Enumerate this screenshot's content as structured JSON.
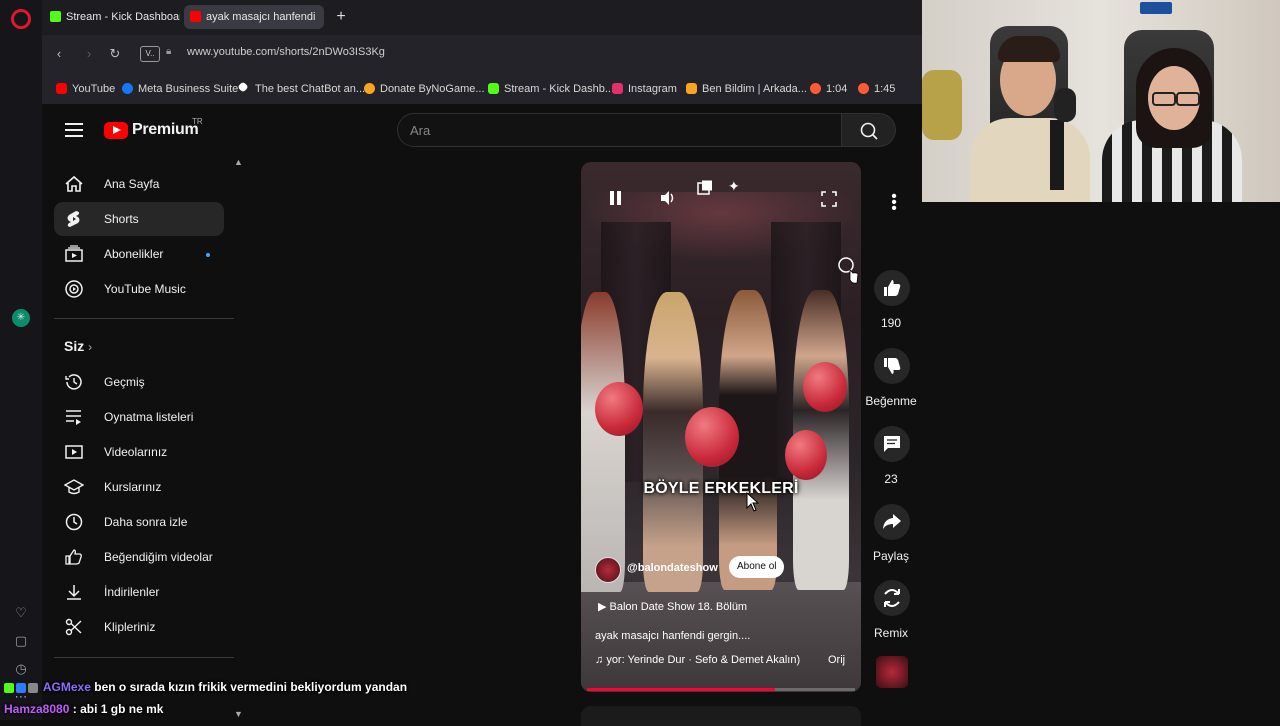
{
  "browser": {
    "tabs": [
      {
        "label": "Stream - Kick Dashboard",
        "active": false,
        "icon": "kick-icon",
        "color": "#53fc18"
      },
      {
        "label": "ayak masajcı hanfendi",
        "active": true,
        "icon": "youtube-icon",
        "color": "#ff0000"
      }
    ],
    "url": "www.youtube.com/shorts/2nDWo3IS3Kg",
    "vpn_label": "V",
    "bookmarks": [
      {
        "label": "YouTube",
        "icon": "youtube-icon",
        "color": "#ff0000"
      },
      {
        "label": "Meta Business Suite",
        "icon": "meta-icon",
        "color": "#1877f2"
      },
      {
        "label": "The best ChatBot an...",
        "icon": "chatbot-icon",
        "color": "#ffffff"
      },
      {
        "label": "Donate ByNoGame...",
        "icon": "bynogame-icon",
        "color": "#f5a623"
      },
      {
        "label": "Stream - Kick Dashb...",
        "icon": "kick-icon",
        "color": "#53fc18"
      },
      {
        "label": "Instagram",
        "icon": "instagram-icon",
        "color": "#e1306c"
      },
      {
        "label": "Ben Bildim | Arkada...",
        "icon": "benbildim-icon",
        "color": "#f5a623"
      },
      {
        "label": "1:04",
        "icon": "timer-icon",
        "color": "#ff5a36"
      },
      {
        "label": "1:45",
        "icon": "timer-icon",
        "color": "#ff5a36"
      }
    ]
  },
  "youtube": {
    "brand": "Premium",
    "country": "TR",
    "search_placeholder": "Ara",
    "sidebar_main": [
      {
        "label": "Ana Sayfa",
        "icon": "home-icon",
        "active": false
      },
      {
        "label": "Shorts",
        "icon": "shorts-icon",
        "active": true
      },
      {
        "label": "Abonelikler",
        "icon": "subscriptions-icon",
        "active": false,
        "dot": true
      },
      {
        "label": "YouTube Music",
        "icon": "youtube-music-icon",
        "active": false
      }
    ],
    "you_section": "Siz",
    "sidebar_you": [
      {
        "label": "Geçmiş",
        "icon": "history-icon"
      },
      {
        "label": "Oynatma listeleri",
        "icon": "playlists-icon"
      },
      {
        "label": "Videolarınız",
        "icon": "your-videos-icon"
      },
      {
        "label": "Kurslarınız",
        "icon": "courses-icon"
      },
      {
        "label": "Daha sonra izle",
        "icon": "watch-later-icon"
      },
      {
        "label": "Beğendiğim videolar",
        "icon": "liked-videos-icon"
      },
      {
        "label": "İndirilenler",
        "icon": "downloads-icon"
      },
      {
        "label": "Klipleriniz",
        "icon": "clips-icon"
      }
    ]
  },
  "short": {
    "caption": "BÖYLE ERKEKLERİ",
    "channel": "@balondateshow",
    "subscribe": "Abone ol",
    "playlist": "Balon Date Show 18. Bölüm",
    "description": "ayak masajcı hanfendi gergin....",
    "music": "yor: Yerinde Dur · Sefo & Demet Akalın)",
    "original": "Orij",
    "progress": 0.7,
    "likes": "190",
    "dislike_label": "Beğenme",
    "comments": "23",
    "share_label": "Paylaş",
    "remix_label": "Remix"
  },
  "chat": [
    {
      "user": "AGMexe",
      "message": "ben o sırada kızın frikik vermedini bekliyordum yandan"
    },
    {
      "user": "Hamza8080",
      "message": "abi 1 gb ne mk"
    }
  ],
  "colors": {
    "youtube_red": "#ff0000",
    "accent_blue": "#3ea6ff",
    "progress_red": "#ff0033"
  }
}
